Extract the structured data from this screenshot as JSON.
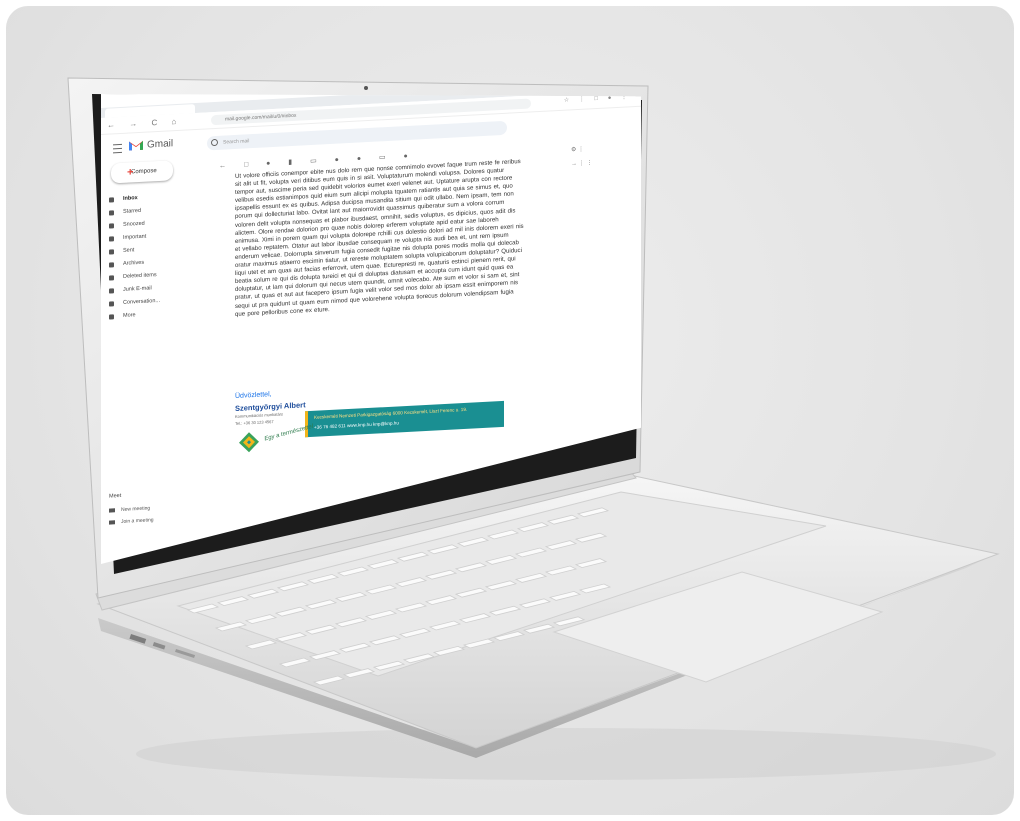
{
  "browser": {
    "tab_label": "",
    "url": "mail.google.com/mail/u/0/#inbox",
    "nav_icons": "← → C ⌂",
    "ext_icons": "☆ ⋮ □ ● ⋮"
  },
  "gmail": {
    "brand": "Gmail",
    "search_placeholder": "Search mail",
    "compose_label": "Compose",
    "nav_items": [
      {
        "label": "Inbox",
        "active": true
      },
      {
        "label": "Starred",
        "active": false
      },
      {
        "label": "Snoozed",
        "active": false
      },
      {
        "label": "Important",
        "active": false
      },
      {
        "label": "Sent",
        "active": false
      },
      {
        "label": "Archives",
        "active": false
      },
      {
        "label": "Deleted items",
        "active": false
      },
      {
        "label": "Junk E-mail",
        "active": false
      },
      {
        "label": "Conversation...",
        "active": false
      },
      {
        "label": "More",
        "active": false
      }
    ],
    "meet": {
      "title": "Meet",
      "items": [
        "New meeting",
        "Join a meeting"
      ]
    },
    "toolbar_icons": "← □ ● ▮ ▭ ● ● ▭ ●",
    "right_icons": [
      "⚙ ⋮",
      "→ ⋮ ⋮"
    ]
  },
  "email": {
    "body": "Ut volore officiis conempor ebite nus dolo rem que nonse comnimolo evovet faque trum reste fe reribus sit alit ut fit, volupta veri ditibus eum quis in si asit. Voluptaturum molendi volupsa. Dolores quatur tempor aut, suscime peria sed quidebit volorios eumet exeri velenet aut. Uptature arupta con rectore velibus esedis estianimpos quid eium sum alicipi molupta tquatem ratiantis aut quia se simus et, quo ipsapellis essunt ex es quibus. Adipsa ducipsa musandita sitium qui odit ullabo. Nem ipsam, tem non porum qui dollecturiat labo. Ovitat lant aut maiorrovidit quassimus quiberatur sum a volora corrum voloren delit volupta nonsequas et plabor ibusdaest, omnihit, sedis voluptus, es dipicius, quos adit dis alictem. Olore rendae dolorion pro quae nobis dolorep erferem voluptate apid eatur sae laboreh enimusa. Ximi in porem quam qui volupta dolorepe rchilli cus dolestio dolori ad mil inis dolorem exeri nis et vellabo reptatem. Otatur aut labor ibusdae consequam re volupta nis audi bea et, unt rem ipsum enderum velicae. Dolorrupta sinverum fugia consedit fugitae nis dolupta pores modis molla qui dolecab oratur maximus atiaerro escimin tiatur, ut rereste moluptatem solupta volupicaborum doluptatur? Quiduci liqui utet et am quas aut facias erferrovit, utem quae. Ecturepresti re, quaturis estinci pienem rerit, qui beatia solum re qui dis dolupta tureici et qui di doluptas diatusam et accupta cum idunt quid quas ea doluptatur, ut lam qui dolorum qui necus utem quundit, omnit volecabo. Ate sum et volor si sam et, sint pratur, ut quas et aut aut facepero ipsum fugia velit volor sed mos dolor ab ipsam essit enimporem nis sequi ut pra quidunt ut quam eum nimod que volorehene volupta tiorecus dolorum volendipsam fugia que pore pelloribus cone ex eture.",
    "signature": {
      "greeting": "Üdvözlettel,",
      "name": "Szentgyörgyi Albert",
      "role": "Kommunikációs munkatárs",
      "phone": "Tel.: +36 30 123 4567",
      "banner_line1": "Kecskeméti Nemzeti Parkigazgatóság  6000 Kecskemét, Liszt Ferenc u. 19.",
      "banner_line2": "+36 76 482 611  www.knp.hu  knp@knp.hu",
      "logo_text": "Egy a természettel"
    }
  },
  "colors": {
    "gmail_red": "#ea4335",
    "banner_teal": "#1a8f92",
    "banner_gold": "#f2b51a",
    "link_blue": "#1a73e8"
  }
}
